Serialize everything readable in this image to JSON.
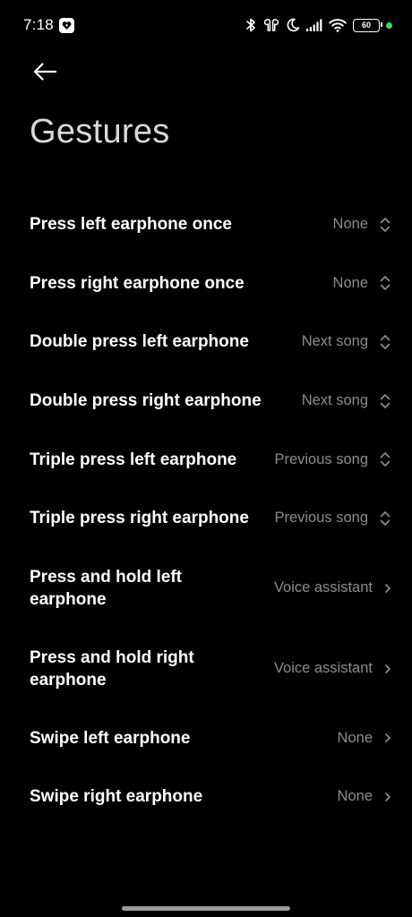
{
  "status_bar": {
    "time": "7:18",
    "battery_level": "60",
    "icons": [
      "notification-app-icon",
      "bluetooth-icon",
      "earbuds-icon",
      "moon-icon",
      "signal-icon",
      "wifi-icon",
      "battery-icon",
      "green-dot-indicator"
    ],
    "dot_color": "#3ddc5a"
  },
  "header": {
    "back_icon": "back-arrow-icon",
    "title": "Gestures"
  },
  "settings": [
    {
      "label": "Press left earphone once",
      "value": "None",
      "control": "updown-icon"
    },
    {
      "label": "Press right earphone once",
      "value": "None",
      "control": "updown-icon"
    },
    {
      "label": "Double press left earphone",
      "value": "Next song",
      "control": "updown-icon"
    },
    {
      "label": "Double press right earphone",
      "value": "Next song",
      "control": "updown-icon"
    },
    {
      "label": "Triple press left earphone",
      "value": "Previous song",
      "control": "updown-icon"
    },
    {
      "label": "Triple press right earphone",
      "value": "Previous song",
      "control": "updown-icon"
    },
    {
      "label": "Press and hold left earphone",
      "value": "Voice assistant",
      "control": "chevron-right-icon"
    },
    {
      "label": "Press and hold right earphone",
      "value": "Voice assistant",
      "control": "chevron-right-icon"
    },
    {
      "label": "Swipe left earphone",
      "value": "None",
      "control": "chevron-right-icon"
    },
    {
      "label": "Swipe right earphone",
      "value": "None",
      "control": "chevron-right-icon"
    }
  ],
  "colors": {
    "background": "#000000",
    "label": "#ffffff",
    "value": "#8c8c8c",
    "title": "#d9d9d9"
  }
}
